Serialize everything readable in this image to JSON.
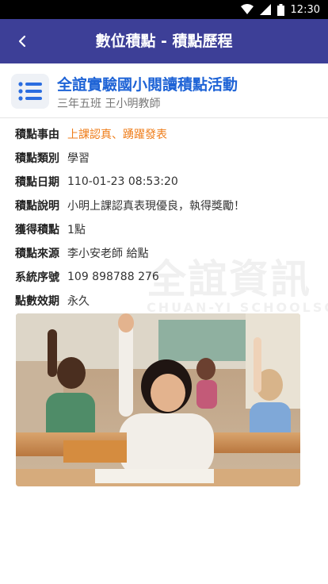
{
  "status_bar": {
    "time": "12:30"
  },
  "header": {
    "title": "數位積點 - 積點歷程"
  },
  "activity": {
    "title": "全誼實驗國小閱讀積點活動",
    "class_teacher": "三年五班 王小明教師"
  },
  "details": [
    {
      "label": "積點事由",
      "value": "上課認真、踴躍發表"
    },
    {
      "label": "積點類別",
      "value": "學習"
    },
    {
      "label": "積點日期",
      "value": "110-01-23 08:53:20"
    },
    {
      "label": "積點說明",
      "value": "小明上課認真表現優良，執得獎勵！"
    },
    {
      "label": "獲得積點",
      "value": "1點"
    },
    {
      "label": "積點來源",
      "value": "李小安老師 給點"
    },
    {
      "label": "系統序號",
      "value": "109 898788 276"
    },
    {
      "label": "點數效期",
      "value": "永久"
    }
  ],
  "watermark": {
    "text": "全誼資訊",
    "subtext": "CHUAN-YI SCHOOLSOFT"
  },
  "colors": {
    "app_bar": "#3d3f97",
    "title_blue": "#1e63d6",
    "accent_orange": "#ef7d1a"
  },
  "icons": {
    "back": "chevron-left-icon",
    "list": "list-icon"
  }
}
